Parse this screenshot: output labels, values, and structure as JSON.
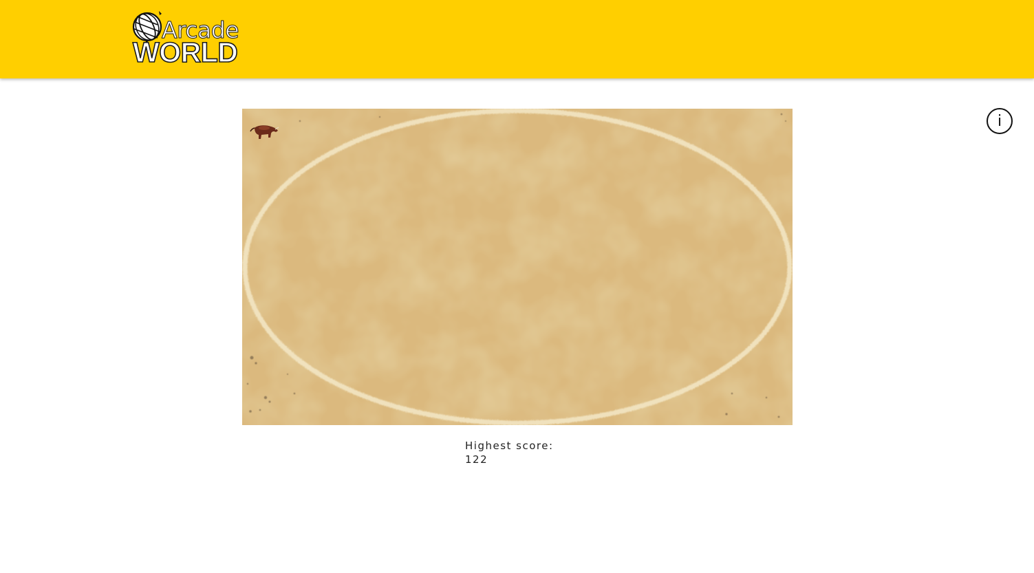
{
  "header": {
    "logo": {
      "line1": "Arcade",
      "line2": "WORLD",
      "icon": "globe-icon"
    },
    "background_color": "#ffcf00"
  },
  "info_button": {
    "label": "i",
    "icon": "info-icon"
  },
  "game": {
    "arena": "sand-oval-ring",
    "character": "bull-sprite"
  },
  "score": {
    "label": "Highest score:",
    "value": "122"
  }
}
